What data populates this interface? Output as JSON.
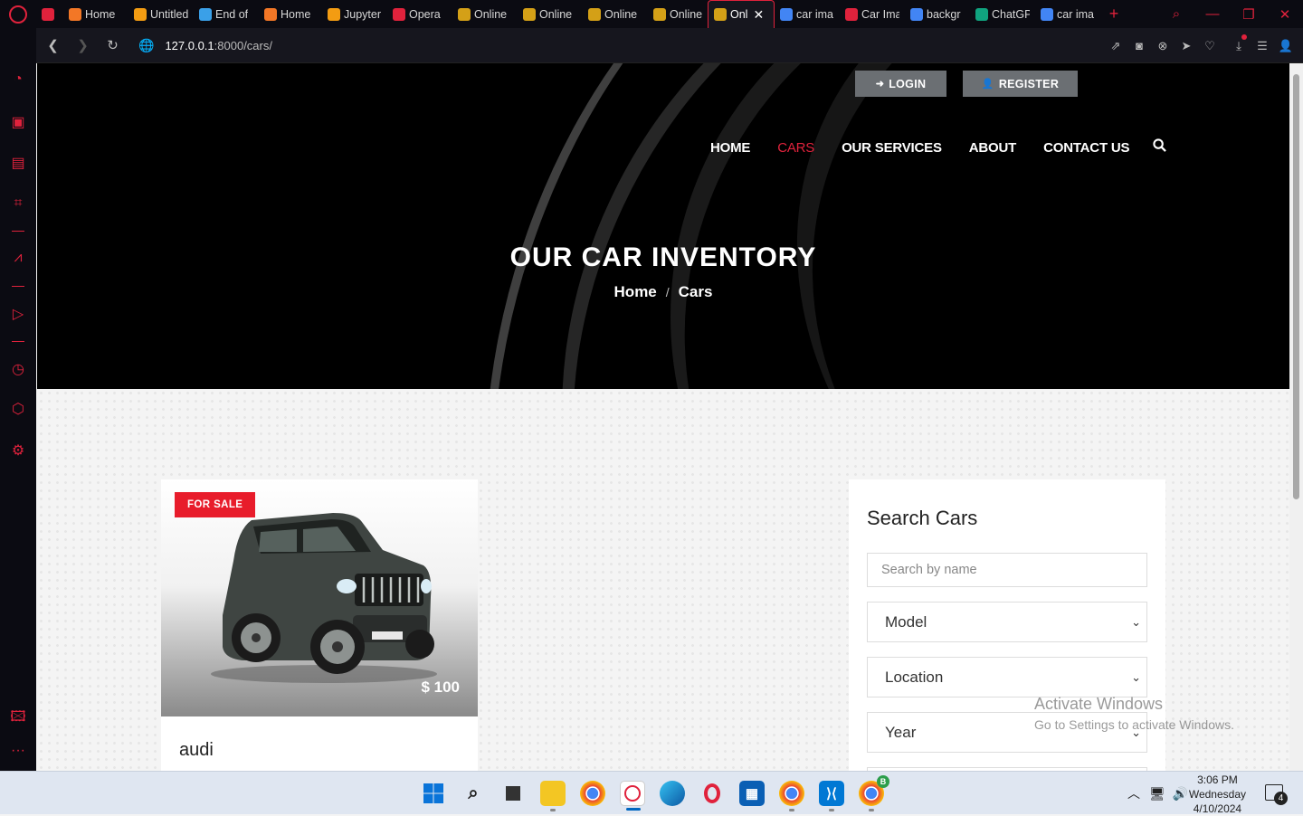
{
  "browser": {
    "tabs": [
      {
        "label": "",
        "icon": "game-controller-icon",
        "fav_color": "#e0223c"
      },
      {
        "label": "Home",
        "icon": "jupyter-icon",
        "fav_color": "#f37726"
      },
      {
        "label": "Untitled",
        "icon": "notebook-icon",
        "fav_color": "#f39c12"
      },
      {
        "label": "End of",
        "icon": "windows-icon",
        "fav_color": "#3aa0e8"
      },
      {
        "label": "Home",
        "icon": "jupyter-icon",
        "fav_color": "#f37726"
      },
      {
        "label": "Jupyter",
        "icon": "notebook-icon",
        "fav_color": "#f39c12"
      },
      {
        "label": "Opera",
        "icon": "opera-icon",
        "fav_color": "#e0223c"
      },
      {
        "label": "Online",
        "icon": "bee-icon",
        "fav_color": "#d4a017"
      },
      {
        "label": "Online",
        "icon": "bee-icon",
        "fav_color": "#d4a017"
      },
      {
        "label": "Online",
        "icon": "bee-icon",
        "fav_color": "#d4a017"
      },
      {
        "label": "Online",
        "icon": "bee-icon",
        "fav_color": "#d4a017"
      },
      {
        "label": "Onl",
        "icon": "bee-icon",
        "fav_color": "#d4a017",
        "active": true
      },
      {
        "label": "car ima",
        "icon": "google-icon",
        "fav_color": "#4285f4"
      },
      {
        "label": "Car Ima",
        "icon": "video-icon",
        "fav_color": "#e0223c"
      },
      {
        "label": "backgr",
        "icon": "google-icon",
        "fav_color": "#4285f4"
      },
      {
        "label": "ChatGP",
        "icon": "chatgpt-icon",
        "fav_color": "#10a37f"
      },
      {
        "label": "car ima",
        "icon": "google-icon",
        "fav_color": "#4285f4"
      }
    ],
    "url_host": "127.0.0.1",
    "url_path": ":8000/cars/"
  },
  "site": {
    "login_label": "LOGIN",
    "register_label": "REGISTER",
    "nav": [
      {
        "label": "HOME",
        "active": false
      },
      {
        "label": "CARS",
        "active": true
      },
      {
        "label": "OUR SERVICES",
        "active": false
      },
      {
        "label": "ABOUT",
        "active": false
      },
      {
        "label": "CONTACT US",
        "active": false
      }
    ],
    "hero_title": "OUR CAR INVENTORY",
    "breadcrumb": {
      "home": "Home",
      "separator": "/",
      "current": "Cars"
    }
  },
  "car_card": {
    "badge": "FOR SALE",
    "price": "$ 100",
    "title": "audi"
  },
  "search_panel": {
    "title": "Search Cars",
    "search_placeholder": "Search by name",
    "selects": [
      "Model",
      "Location",
      "Year"
    ]
  },
  "watermark": {
    "line1": "Activate Windows",
    "line2": "Go to Settings to activate Windows."
  },
  "taskbar": {
    "time": "3:06 PM",
    "day": "Wednesday",
    "date": "4/10/2024",
    "notification_count": "4",
    "badge_b": "B"
  },
  "colors": {
    "accent": "#e0223c",
    "badge_red": "#e81c2b",
    "auth_button": "#6b6f73"
  }
}
